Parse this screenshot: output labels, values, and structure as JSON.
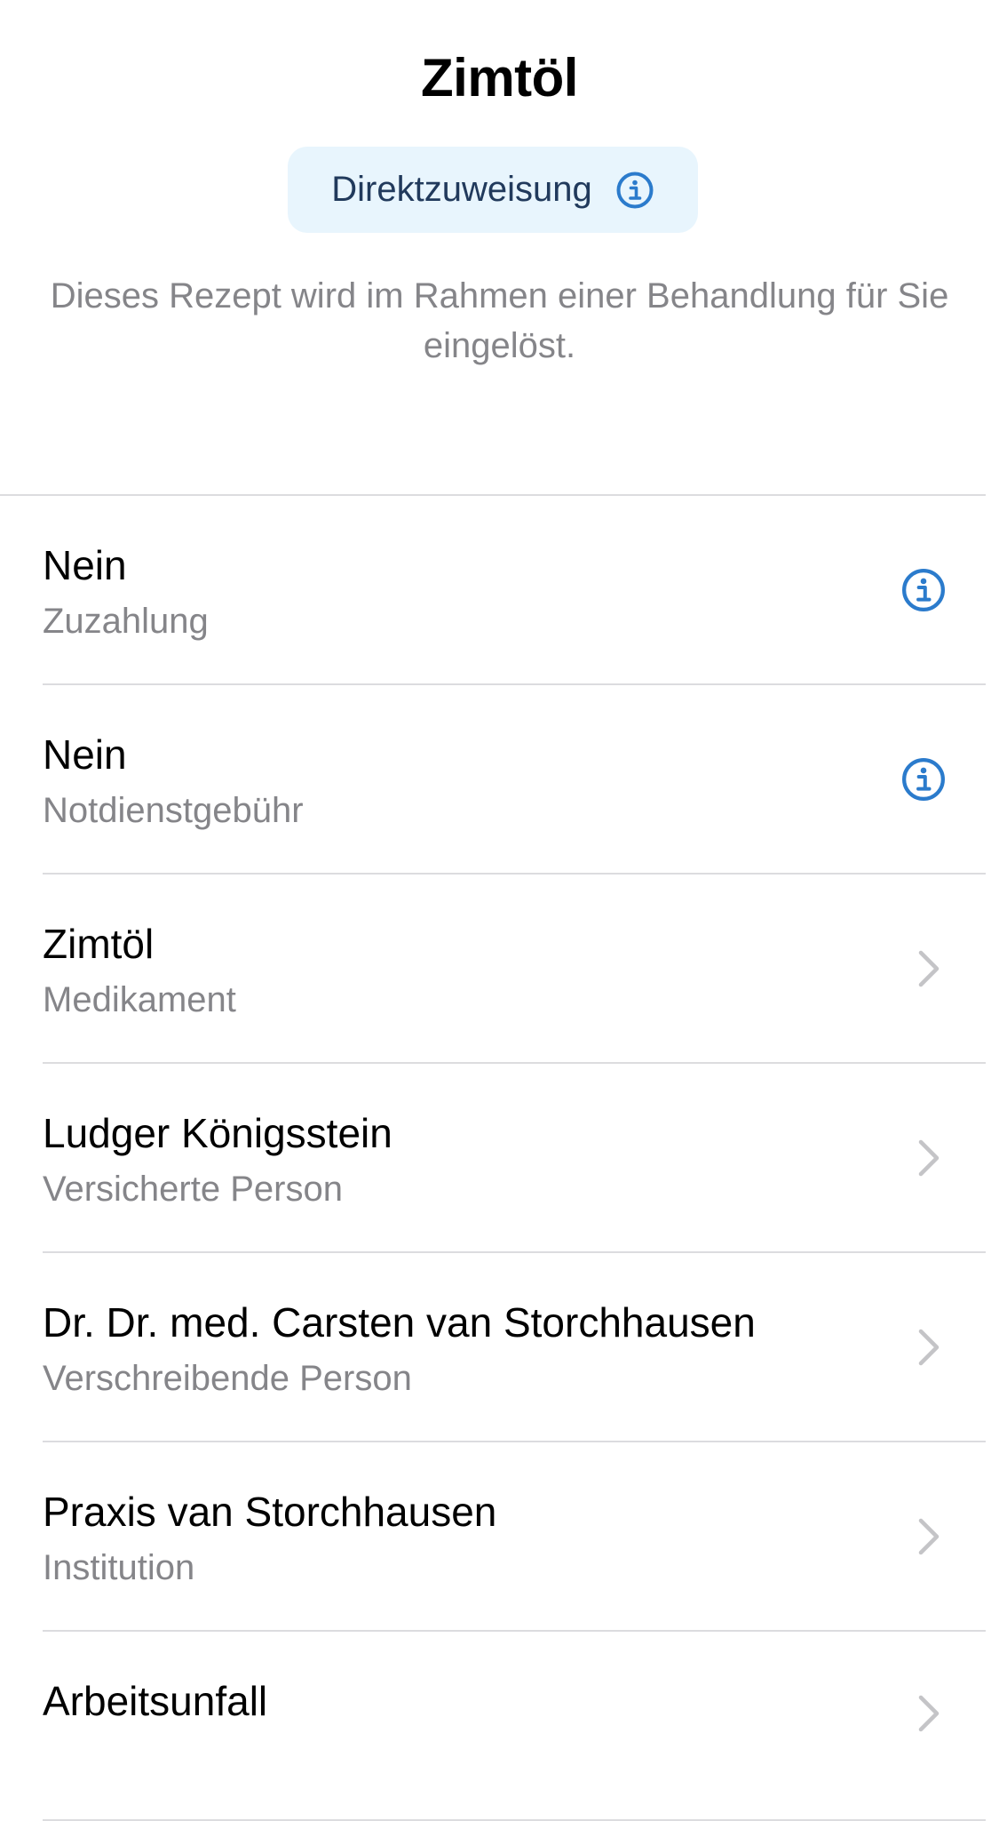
{
  "header": {
    "title": "Zimtöl",
    "badge_label": "Direktzuweisung",
    "description": "Dieses Rezept wird im Rahmen einer Behandlung für Sie eingelöst."
  },
  "rows": [
    {
      "value": "Nein",
      "label": "Zuzahlung",
      "accessory": "info-icon"
    },
    {
      "value": "Nein",
      "label": "Notdienstgebühr",
      "accessory": "info-icon"
    },
    {
      "value": "Zimtöl",
      "label": "Medikament",
      "accessory": "chevron-right-icon"
    },
    {
      "value": "Ludger Königsstein",
      "label": "Versicherte Person",
      "accessory": "chevron-right-icon"
    },
    {
      "value": "Dr. Dr. med. Carsten van Storchhausen",
      "label": "Verschreibende Person",
      "accessory": "chevron-right-icon"
    },
    {
      "value": "Praxis van Storchhausen",
      "label": "Institution",
      "accessory": "chevron-right-icon"
    },
    {
      "value": "Arbeitsunfall",
      "label": "",
      "accessory": "chevron-right-icon"
    }
  ],
  "colors": {
    "accent": "#2b7bcc",
    "badge_background": "#e8f5fd",
    "badge_text": "#213a5c",
    "secondary_text": "#858589",
    "separator": "#dcdcdf",
    "chevron": "#c4c4c7"
  }
}
